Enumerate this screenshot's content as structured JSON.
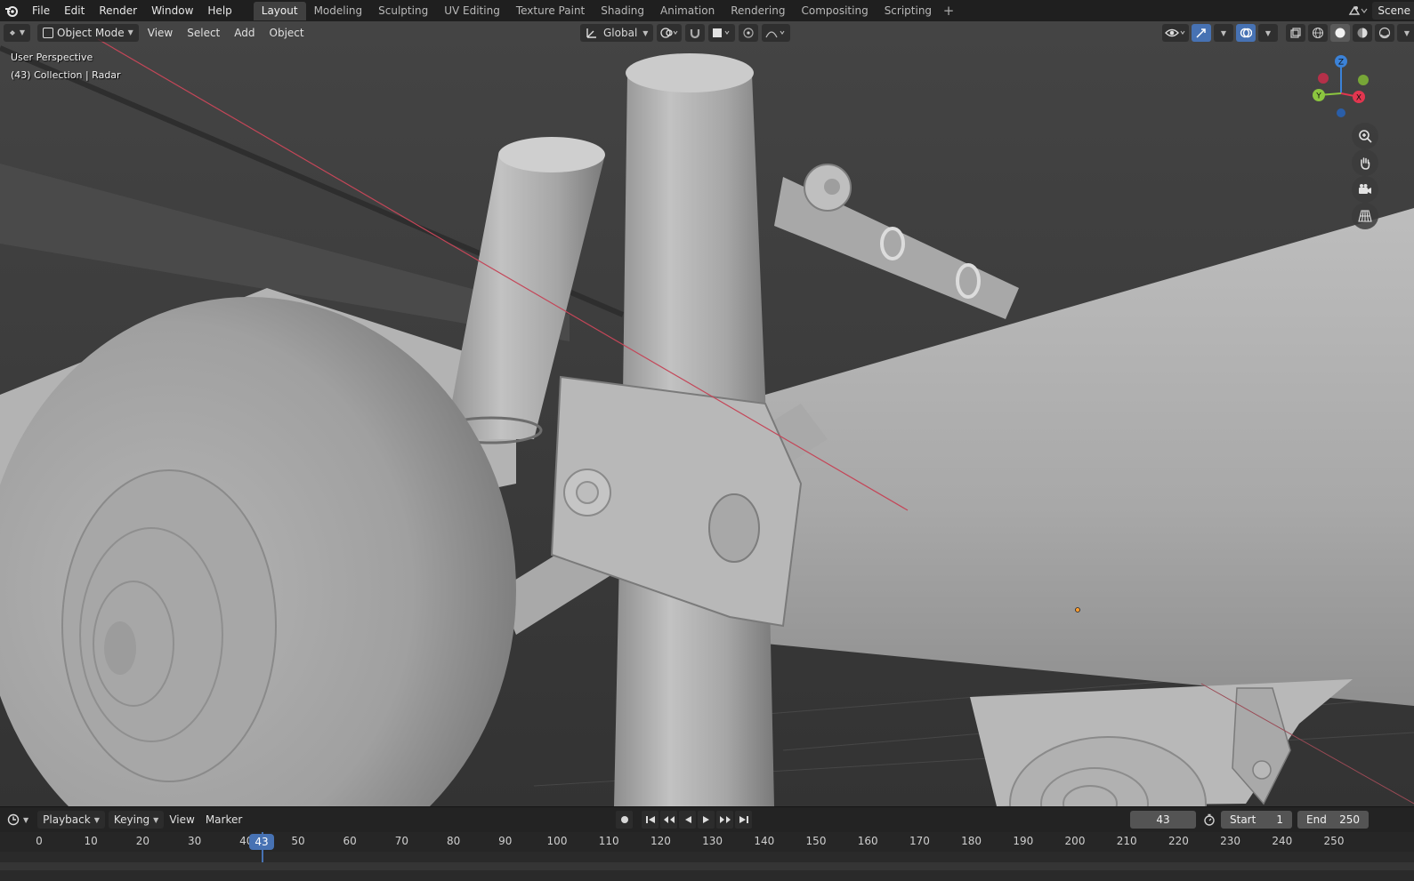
{
  "menubar": {
    "items": [
      "File",
      "Edit",
      "Render",
      "Window",
      "Help"
    ],
    "tabs": [
      "Layout",
      "Modeling",
      "Sculpting",
      "UV Editing",
      "Texture Paint",
      "Shading",
      "Animation",
      "Rendering",
      "Compositing",
      "Scripting"
    ],
    "active_tab": "Layout",
    "add_tab_symbol": "+",
    "scene_label": "Scene"
  },
  "viewport_header": {
    "mode": "Object Mode",
    "menus": [
      "View",
      "Select",
      "Add",
      "Object"
    ],
    "transform_orientation": "Global"
  },
  "viewport": {
    "perspective_label": "User Perspective",
    "collection_label": "(43) Collection | Radar",
    "gizmo_axes": {
      "z": "Z",
      "y": "Y",
      "x": "X"
    },
    "colors": {
      "x_axis": "#e2364f",
      "y_axis": "#8cc63f",
      "z_axis": "#3b82d8",
      "background": "#3a3a3a"
    }
  },
  "timeline": {
    "menus": [
      "Playback",
      "Keying",
      "View",
      "Marker"
    ],
    "current_frame": "43",
    "start_label": "Start",
    "start_value": "1",
    "end_label": "End",
    "end_value": "250",
    "ticks": [
      "0",
      "10",
      "20",
      "30",
      "40",
      "50",
      "60",
      "70",
      "80",
      "90",
      "100",
      "110",
      "120",
      "130",
      "140",
      "150",
      "160",
      "170",
      "180",
      "190",
      "200",
      "210",
      "220",
      "230",
      "240",
      "250"
    ],
    "accent_color": "#4772b3"
  }
}
